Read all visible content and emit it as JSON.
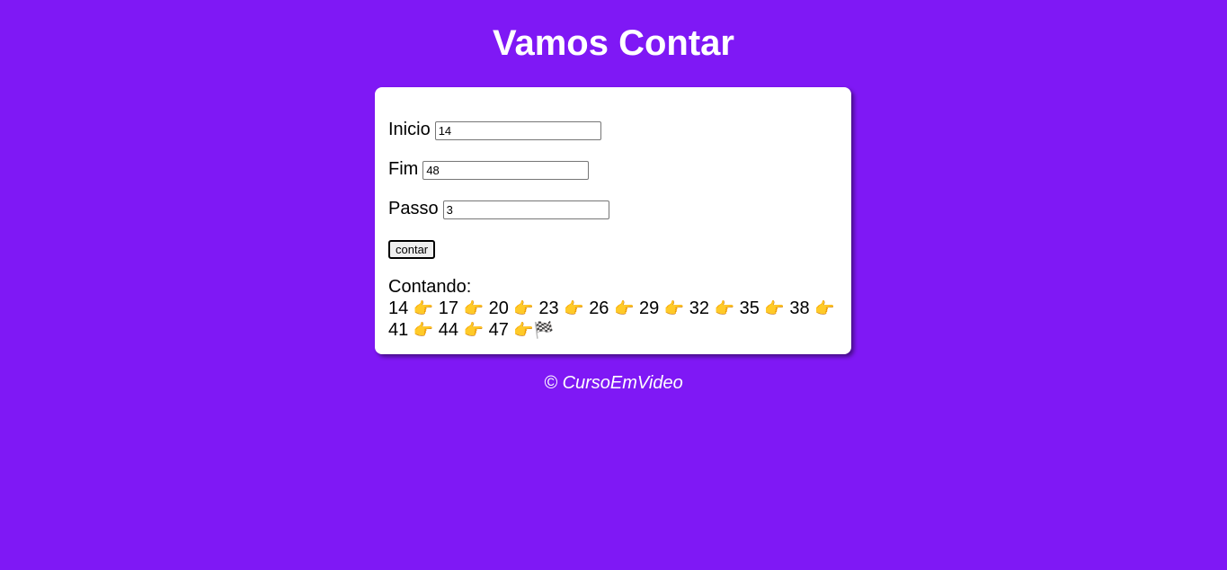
{
  "header": {
    "title": "Vamos Contar"
  },
  "form": {
    "inicio_label": "Inicio",
    "inicio_value": "14",
    "fim_label": "Fim",
    "fim_value": "48",
    "passo_label": "Passo",
    "passo_value": "3",
    "button_label": "contar"
  },
  "result": {
    "heading": "Contando:",
    "values": [
      "14",
      "17",
      "20",
      "23",
      "26",
      "29",
      "32",
      "35",
      "38",
      "41",
      "44",
      "47"
    ],
    "separator_icon": "finger-pointing-right-icon",
    "separator_glyph": "👉",
    "end_icon": "checkered-flag-icon",
    "end_glyph": "🏁"
  },
  "footer": {
    "text": "© CursoEmVideo"
  },
  "colors": {
    "background": "#7f18f5",
    "card": "#ffffff",
    "title": "#ffffff"
  }
}
